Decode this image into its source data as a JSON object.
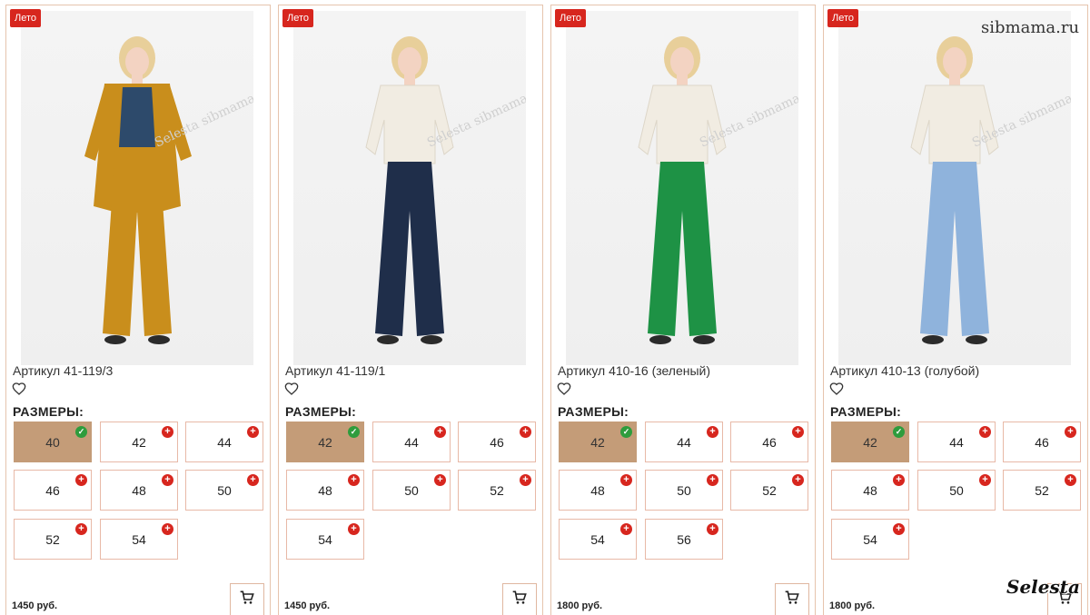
{
  "site_watermark": "sibmama.ru",
  "brand_watermark": "Selesta",
  "colors": {
    "badge": "#d7261e",
    "selected_size": "#c49c78",
    "card_border": "#e6c4ad",
    "check": "#2e9c3d",
    "plus": "#d7261e"
  },
  "products": [
    {
      "badge": "Лето",
      "title": "Артикул 41-119/3",
      "sizes_label": "РАЗМЕРЫ:",
      "sizes": [
        {
          "label": "40",
          "selected": true
        },
        {
          "label": "42",
          "selected": false
        },
        {
          "label": "44",
          "selected": false
        },
        {
          "label": "46",
          "selected": false
        },
        {
          "label": "48",
          "selected": false
        },
        {
          "label": "50",
          "selected": false
        },
        {
          "label": "52",
          "selected": false
        },
        {
          "label": "54",
          "selected": false
        }
      ],
      "price": "1450 руб.",
      "outfit": {
        "jacket": "#c98e1c",
        "top": "#2d4a6b",
        "pants": "#c98e1c"
      }
    },
    {
      "badge": "Лето",
      "title": "Артикул 41-119/1",
      "sizes_label": "РАЗМЕРЫ:",
      "sizes": [
        {
          "label": "42",
          "selected": true
        },
        {
          "label": "44",
          "selected": false
        },
        {
          "label": "46",
          "selected": false
        },
        {
          "label": "48",
          "selected": false
        },
        {
          "label": "50",
          "selected": false
        },
        {
          "label": "52",
          "selected": false
        },
        {
          "label": "54",
          "selected": false
        }
      ],
      "price": "1450 руб.",
      "outfit": {
        "jacket": "",
        "top": "#f1ece2",
        "pants": "#1f2e4a"
      }
    },
    {
      "badge": "Лето",
      "title": "Артикул 410-16 (зеленый)",
      "sizes_label": "РАЗМЕРЫ:",
      "sizes": [
        {
          "label": "42",
          "selected": true
        },
        {
          "label": "44",
          "selected": false
        },
        {
          "label": "46",
          "selected": false
        },
        {
          "label": "48",
          "selected": false
        },
        {
          "label": "50",
          "selected": false
        },
        {
          "label": "52",
          "selected": false
        },
        {
          "label": "54",
          "selected": false
        },
        {
          "label": "56",
          "selected": false
        }
      ],
      "price": "1800 руб.",
      "outfit": {
        "jacket": "",
        "top": "#f1ece2",
        "pants": "#1e9245"
      }
    },
    {
      "badge": "Лето",
      "title": "Артикул 410-13 (голубой)",
      "sizes_label": "РАЗМЕРЫ:",
      "sizes": [
        {
          "label": "42",
          "selected": true
        },
        {
          "label": "44",
          "selected": false
        },
        {
          "label": "46",
          "selected": false
        },
        {
          "label": "48",
          "selected": false
        },
        {
          "label": "50",
          "selected": false
        },
        {
          "label": "52",
          "selected": false
        },
        {
          "label": "54",
          "selected": false
        }
      ],
      "price": "1800 руб.",
      "outfit": {
        "jacket": "",
        "top": "#f1ece2",
        "pants": "#8fb3dc"
      }
    }
  ]
}
